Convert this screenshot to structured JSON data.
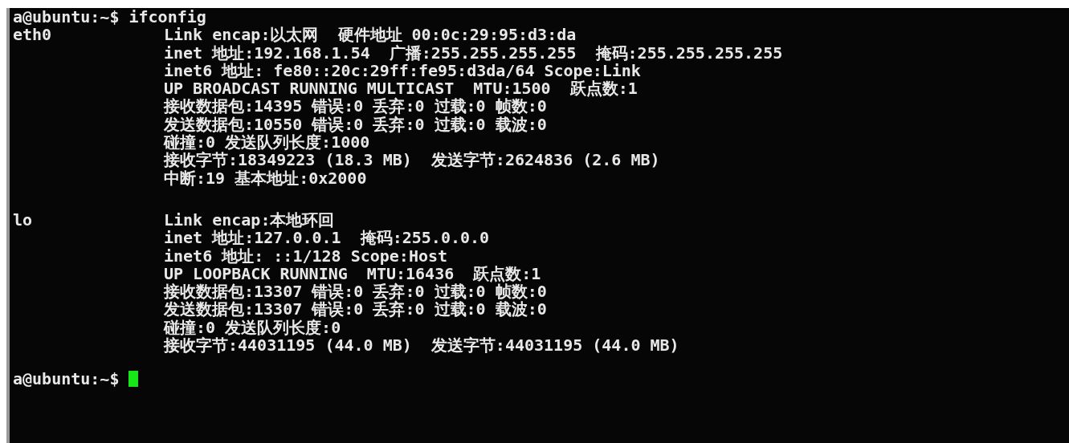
{
  "terminal": {
    "command_line": "a@ubuntu:~$ ifconfig",
    "interfaces": [
      {
        "name": "eth0",
        "lines": [
          "Link encap:以太网  硬件地址 00:0c:29:95:d3:da",
          "inet 地址:192.168.1.54  广播:255.255.255.255  掩码:255.255.255.255",
          "inet6 地址: fe80::20c:29ff:fe95:d3da/64 Scope:Link",
          "UP BROADCAST RUNNING MULTICAST  MTU:1500  跃点数:1",
          "接收数据包:14395 错误:0 丢弃:0 过载:0 帧数:0",
          "发送数据包:10550 错误:0 丢弃:0 过载:0 载波:0",
          "碰撞:0 发送队列长度:1000",
          "接收字节:18349223 (18.3 MB)  发送字节:2624836 (2.6 MB)",
          "中断:19 基本地址:0x2000"
        ]
      },
      {
        "name": "lo",
        "lines": [
          "Link encap:本地环回",
          "inet 地址:127.0.0.1  掩码:255.0.0.0",
          "inet6 地址: ::1/128 Scope:Host",
          "UP LOOPBACK RUNNING  MTU:16436  跃点数:1",
          "接收数据包:13307 错误:0 丢弃:0 过载:0 帧数:0",
          "发送数据包:13307 错误:0 丢弃:0 过载:0 载波:0",
          "碰撞:0 发送队列长度:0",
          "接收字节:44031195 (44.0 MB)  发送字节:44031195 (44.0 MB)"
        ]
      }
    ],
    "prompt": "a@ubuntu:~$"
  }
}
